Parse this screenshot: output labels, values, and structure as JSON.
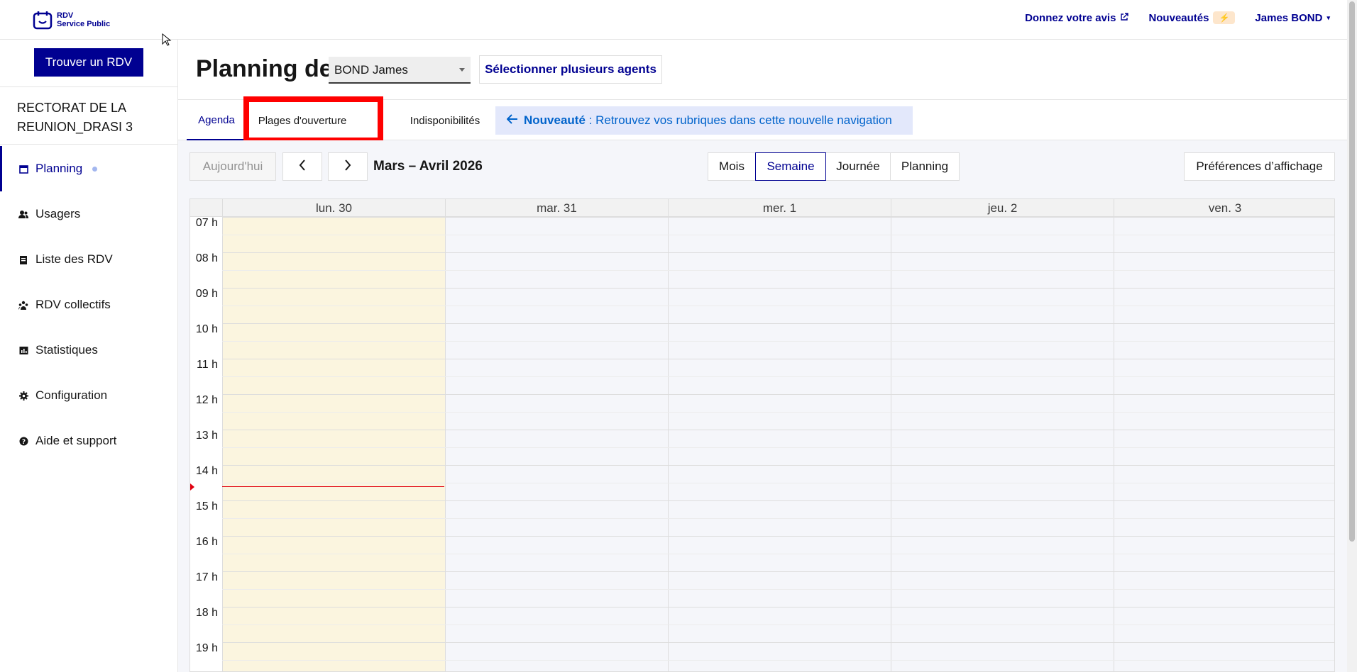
{
  "header": {
    "logo_line1": "RDV",
    "logo_line2": "Service Public",
    "feedback": "Donnez votre avis",
    "news": "Nouveautés",
    "news_badge": "⚡",
    "user": "James BOND"
  },
  "sidebar": {
    "find_button": "Trouver un RDV",
    "org_name": "RECTORAT DE LA REUNION_DRASI 3",
    "items": [
      {
        "label": "Planning",
        "icon": "calendar-icon"
      },
      {
        "label": "Usagers",
        "icon": "users-icon"
      },
      {
        "label": "Liste des RDV",
        "icon": "list-icon"
      },
      {
        "label": "RDV collectifs",
        "icon": "group-icon"
      },
      {
        "label": "Statistiques",
        "icon": "chart-icon"
      },
      {
        "label": "Configuration",
        "icon": "gear-icon"
      },
      {
        "label": "Aide et support",
        "icon": "help-icon"
      }
    ]
  },
  "page": {
    "title": "Planning de",
    "agent_selected": "BOND James",
    "multi_agents_button": "Sélectionner plusieurs agents"
  },
  "tabs": {
    "agenda": "Agenda",
    "plages": "Plages d'ouverture",
    "indispo": "Indisponibilités"
  },
  "notice": {
    "bold": "Nouveauté",
    "text": " : Retrouvez vos rubriques dans cette nouvelle navigation"
  },
  "toolbar": {
    "today": "Aujourd'hui",
    "range": "Mars – Avril 2026",
    "views": [
      "Mois",
      "Semaine",
      "Journée",
      "Planning"
    ],
    "active_view": "Semaine",
    "prefs": "Préférences d’affichage"
  },
  "calendar": {
    "days": [
      "lun. 30",
      "mar. 31",
      "mer. 1",
      "jeu. 2",
      "ven. 3"
    ],
    "hours": [
      "07 h",
      "08 h",
      "09 h",
      "10 h",
      "11 h",
      "12 h",
      "13 h",
      "14 h",
      "15 h",
      "16 h",
      "17 h",
      "18 h",
      "19 h"
    ]
  }
}
